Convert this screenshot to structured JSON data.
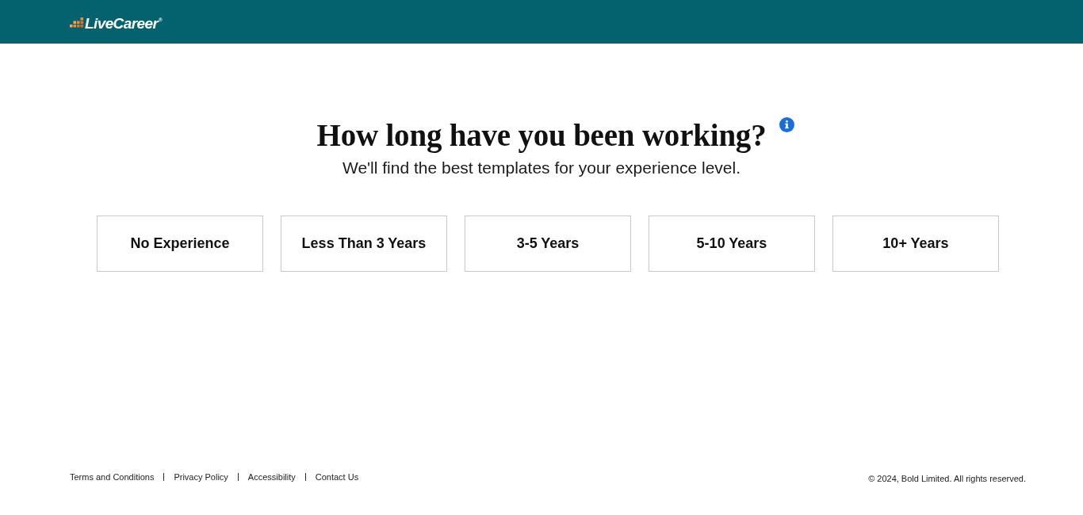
{
  "header": {
    "logo": "LiveCareer$^{®}$"
  },
  "question": {
    "title": "How long have you been working?",
    "subtitle": "We'll find the best templates for your experience level."
  },
  "options": [
    {
      "label": "No Experience",
      "selected": false
    },
    {
      "label": "Less Than 3 Years",
      "selected": false
    },
    {
      "label": "3-5 Years",
      "selected": false
    },
    {
      "label": "5-10 Years",
      "selected": false
    },
    {
      "label": "10+ Years",
      "selected": false
    }
  ],
  "footer": {
    "links": [
      "Terms and Conditions",
      "Privacy Policy",
      "Accessibility",
      "Contact Us"
    ],
    "copyright": "© 2024, Bold Limited. All rights reserved."
  }
}
